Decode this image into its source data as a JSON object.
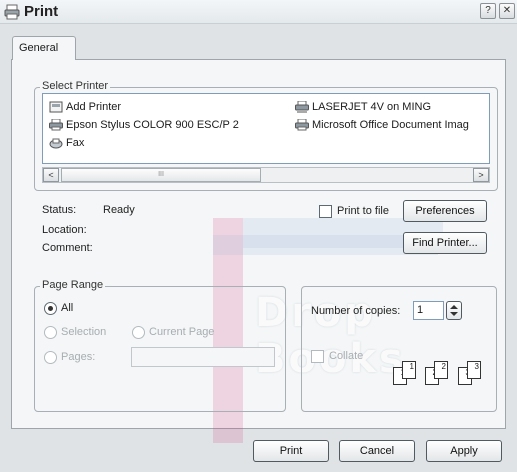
{
  "window": {
    "title": "Print",
    "help_glyph": "?",
    "close_glyph": "✕"
  },
  "tabs": [
    {
      "label": "General",
      "active": true
    }
  ],
  "select_printer": {
    "legend": "Select Printer",
    "printers": [
      {
        "label": "Add Printer",
        "icon": "add-printer-icon"
      },
      {
        "label": "Epson Stylus COLOR 900 ESC/P 2",
        "icon": "printer-icon"
      },
      {
        "label": "Fax",
        "icon": "fax-icon"
      },
      {
        "label": "LASERJET 4V on MING",
        "icon": "network-printer-icon"
      },
      {
        "label": "Microsoft Office Document Imag",
        "icon": "printer-icon"
      }
    ],
    "scroll_left": "<",
    "scroll_right": ">",
    "scroll_thumb_grip": "III"
  },
  "status": {
    "status_label": "Status:",
    "status_value": "Ready",
    "location_label": "Location:",
    "comment_label": "Comment:",
    "print_to_file_label": "Print to file",
    "print_to_file_checked": false,
    "preferences_button": "Preferences",
    "find_printer_button": "Find Printer..."
  },
  "page_range": {
    "legend": "Page Range",
    "all_label": "All",
    "selection_label": "Selection",
    "current_page_label": "Current Page",
    "pages_label": "Pages:",
    "pages_value": "",
    "selected": "All"
  },
  "copies": {
    "number_of_copies_label": "Number of copies:",
    "copies_value": "1",
    "collate_label": "Collate",
    "collate_checked": false,
    "collate_pages": [
      "1",
      "1",
      "2",
      "2",
      "3",
      "3"
    ]
  },
  "footer": {
    "print_button": "Print",
    "cancel_button": "Cancel",
    "apply_button": "Apply"
  },
  "watermark": {
    "text": "Drop Books"
  },
  "colors": {
    "window_bg": "#dfe3e6",
    "panel_bg": "#f4f6f7",
    "list_border": "#7f9db9"
  }
}
